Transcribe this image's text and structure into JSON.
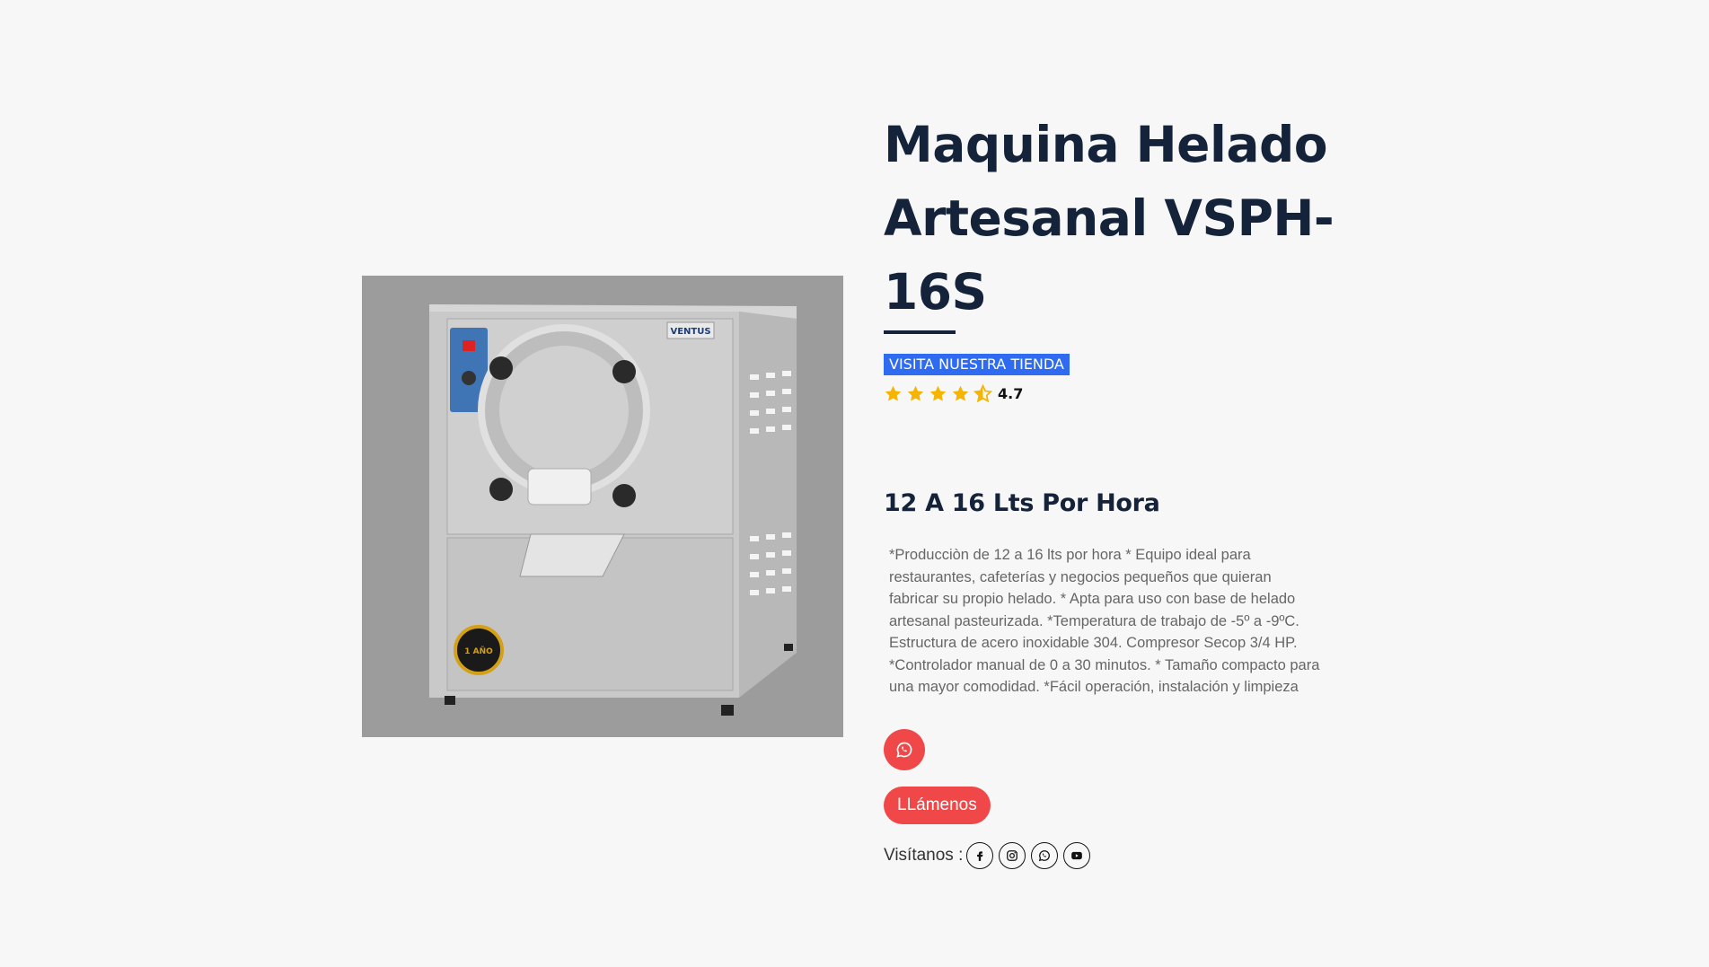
{
  "product": {
    "title": "Maquina Helado Artesanal VSPH-16S",
    "store_link": "VISITA NUESTRA TIENDA",
    "rating": "4.7",
    "stars": 4.5,
    "subtitle": "12 A 16 Lts Por Hora",
    "description": "*Producciòn de 12 a 16 lts por hora * Equipo ideal para restaurantes, cafeterías y negocios pequeños que quieran fabricar su propio helado. * Apta para uso con base de helado artesanal pasteurizada. *Temperatura de trabajo de -5º a -9ºC. Estructura de acero inoxidable 304. Compresor Secop 3/4 HP. *Controlador manual de 0 a 30 minutos. * Tamaño compacto para una mayor comodidad. *Fácil operación, instalación y limpieza",
    "image_brand": "VENTUS",
    "image_badge": "1 AÑO"
  },
  "actions": {
    "whatsapp_icon": "whatsapp-icon",
    "call_label": "LLámenos"
  },
  "social": {
    "label": "Visítanos :",
    "icons": [
      "facebook-icon",
      "instagram-icon",
      "whatsapp-icon",
      "youtube-icon"
    ]
  },
  "colors": {
    "accent_red": "#f04848",
    "link_blue": "#2f6bf0",
    "title_navy": "#14233a",
    "star_gold": "#f5b400"
  }
}
